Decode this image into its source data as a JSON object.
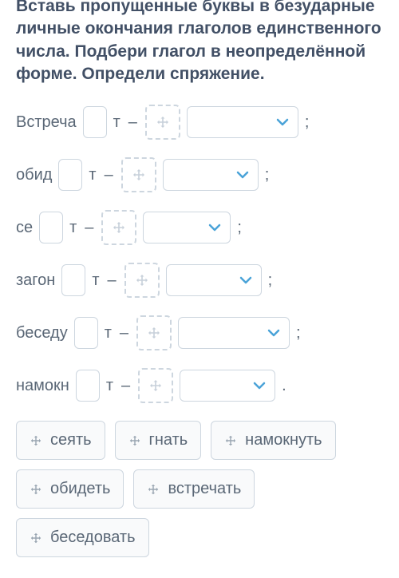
{
  "instructions": "Вставь пропущенные буквы в безударные личные окончания глаголов единственного числа. Подбери глагол в неопределённой форме. Определи спряжение.",
  "rows": [
    {
      "prefix": "Встреча",
      "suffix": "т",
      "dash": "–",
      "punct": ";",
      "select_width": "wide"
    },
    {
      "prefix": "обид",
      "suffix": "т",
      "dash": "–",
      "punct": ";",
      "select_width": "med"
    },
    {
      "prefix": "се",
      "suffix": "т",
      "dash": "–",
      "punct": ";",
      "select_width": "narrow"
    },
    {
      "prefix": "загон",
      "suffix": "т",
      "dash": "–",
      "punct": ";",
      "select_width": "med"
    },
    {
      "prefix": "беседу",
      "suffix": "т",
      "dash": "–",
      "punct": ";",
      "select_width": "wide"
    },
    {
      "prefix": "намокн",
      "suffix": "т",
      "dash": "–",
      "punct": ".",
      "select_width": "med"
    }
  ],
  "bank": [
    {
      "label": "сеять"
    },
    {
      "label": "гнать"
    },
    {
      "label": "намокнуть"
    },
    {
      "label": "обидеть"
    },
    {
      "label": "встречать"
    },
    {
      "label": "беседовать"
    }
  ]
}
